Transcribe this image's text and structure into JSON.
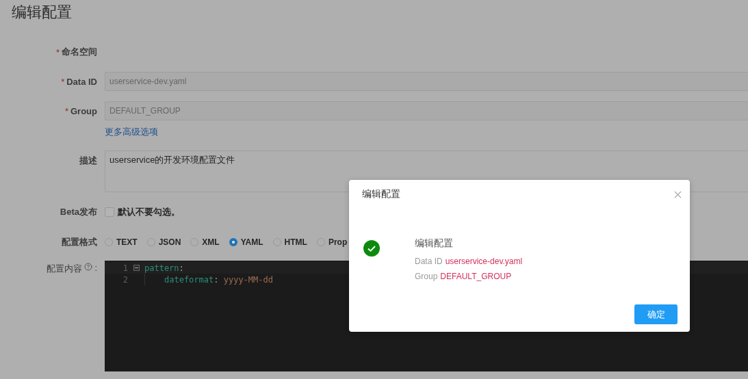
{
  "page": {
    "title": "编辑配置"
  },
  "fields": [
    {
      "kind": "static",
      "required_mark": "*",
      "label": "命名空间"
    },
    {
      "kind": "input",
      "required_mark": "*",
      "label": "Data ID",
      "value": "userservice-dev.yaml",
      "disabled": true
    },
    {
      "kind": "input",
      "required_mark": "*",
      "label": "Group",
      "value": "DEFAULT_GROUP",
      "disabled": true
    }
  ],
  "advanced_link": "更多高级选项",
  "description": {
    "label": "描述",
    "value": "userservice的开发环境配置文件"
  },
  "beta": {
    "label": "Beta发布",
    "checked": false,
    "text": "默认不要勾选。"
  },
  "format": {
    "label": "配置格式",
    "options": [
      {
        "label": "TEXT",
        "selected": false
      },
      {
        "label": "JSON",
        "selected": false
      },
      {
        "label": "XML",
        "selected": false
      },
      {
        "label": "YAML",
        "selected": true
      },
      {
        "label": "HTML",
        "selected": false
      },
      {
        "label": "Prop",
        "selected": false
      }
    ]
  },
  "content": {
    "label": "配置内容",
    "colon": ":",
    "lines": [
      {
        "number": "1",
        "expanded": true,
        "tokens": [
          {
            "kind": "key",
            "text": "pattern"
          },
          {
            "kind": "punct",
            "text": ":"
          }
        ],
        "children": [
          {
            "number": "2",
            "tokens": [
              {
                "kind": "key",
                "text": "dateformat"
              },
              {
                "kind": "punct",
                "text": ": "
              },
              {
                "kind": "value",
                "text": "yyyy-MM-dd"
              }
            ]
          }
        ]
      }
    ]
  },
  "dialog": {
    "title": "编辑配置",
    "success": true,
    "heading": "编辑配置",
    "details": [
      {
        "label": "Data ID",
        "value": "userservice-dev.yaml"
      },
      {
        "label": "Group",
        "value": "DEFAULT_GROUP"
      }
    ],
    "button": "确定"
  }
}
